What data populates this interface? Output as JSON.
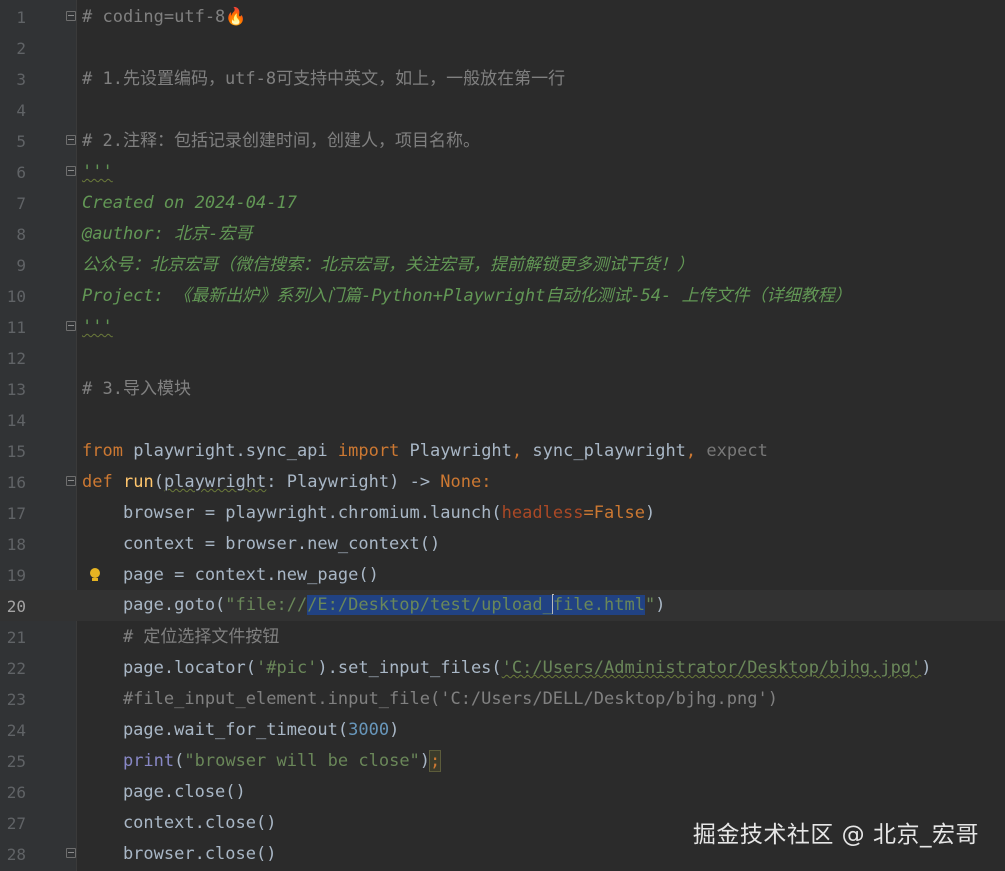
{
  "editor": {
    "current_line": 20,
    "line_numbers": [
      "1",
      "2",
      "3",
      "4",
      "5",
      "6",
      "7",
      "8",
      "9",
      "10",
      "11",
      "12",
      "13",
      "14",
      "15",
      "16",
      "17",
      "18",
      "19",
      "20",
      "21",
      "22",
      "23",
      "24",
      "25",
      "26",
      "27",
      "28"
    ],
    "lines": {
      "l1": "# coding=utf-8",
      "l1_emoji": "🔥",
      "l3": "# 1.先设置编码，utf-8可支持中英文，如上，一般放在第一行",
      "l5": "# 2.注释：包括记录创建时间，创建人，项目名称。",
      "l6": "'''",
      "l7": "Created on 2024-04-17",
      "l8": "@author: 北京-宏哥",
      "l9": "公众号：北京宏哥（微信搜索：北京宏哥，关注宏哥，提前解锁更多测试干货！）",
      "l10": "Project: 《最新出炉》系列入门篇-Python+Playwright自动化测试-54- 上传文件（详细教程）",
      "l11": "'''",
      "l13": "# 3.导入模块",
      "l15": {
        "k1": "from",
        "a": " playwright.sync_api ",
        "k2": "import",
        "b": " Playwright",
        "c": ",",
        "d": " sync_playwright",
        "e": ",",
        "f": " expect"
      },
      "l16": {
        "k1": "def",
        "sp": " ",
        "fn": "run",
        "p1": "(",
        "param": "playwright",
        "p2": ": Playwright) -> ",
        "none": "None",
        ":": ":"
      },
      "l17": {
        "a": "    browser = playwright.chromium.launch(",
        "kw": "headless",
        "eq": "=",
        "val": "False",
        "b": ")"
      },
      "l18": "    context = browser.new_context()",
      "l19": "    page = context.new_page()",
      "l20": {
        "a": "    page.goto(",
        "q1": "\"file://",
        "sel1": "/E:/Desktop/test/upload_",
        "sel2": "file.html",
        "q2": "\"",
        "b": ")"
      },
      "l21": "    # 定位选择文件按钮",
      "l22": {
        "a": "    page.locator(",
        "s1": "'#pic'",
        "b": ").set_input_files(",
        "s2": "'C:/Users/Administrator/Desktop/bjhg.jpg'",
        "c": ")"
      },
      "l23": "    #file_input_element.input_file('C:/Users/DELL/Desktop/bjhg.png')",
      "l24": {
        "a": "    page.wait_for_timeout(",
        "n": "3000",
        "b": ")"
      },
      "l25": {
        "a": "    ",
        "fn": "print",
        "b": "(",
        "s": "\"browser will be close\"",
        "c": ")",
        "semi": ";"
      },
      "l26": "    page.close()",
      "l27": "    context.close()",
      "l28": "    browser.close()"
    }
  },
  "watermark": "掘金技术社区 @ 北京_宏哥",
  "colors": {
    "background": "#2b2b2b",
    "gutter": "#313335",
    "comment": "#808080",
    "docstring": "#629755",
    "keyword": "#cc7832",
    "string": "#6a8759",
    "number": "#6897bb",
    "selection": "#214283"
  }
}
